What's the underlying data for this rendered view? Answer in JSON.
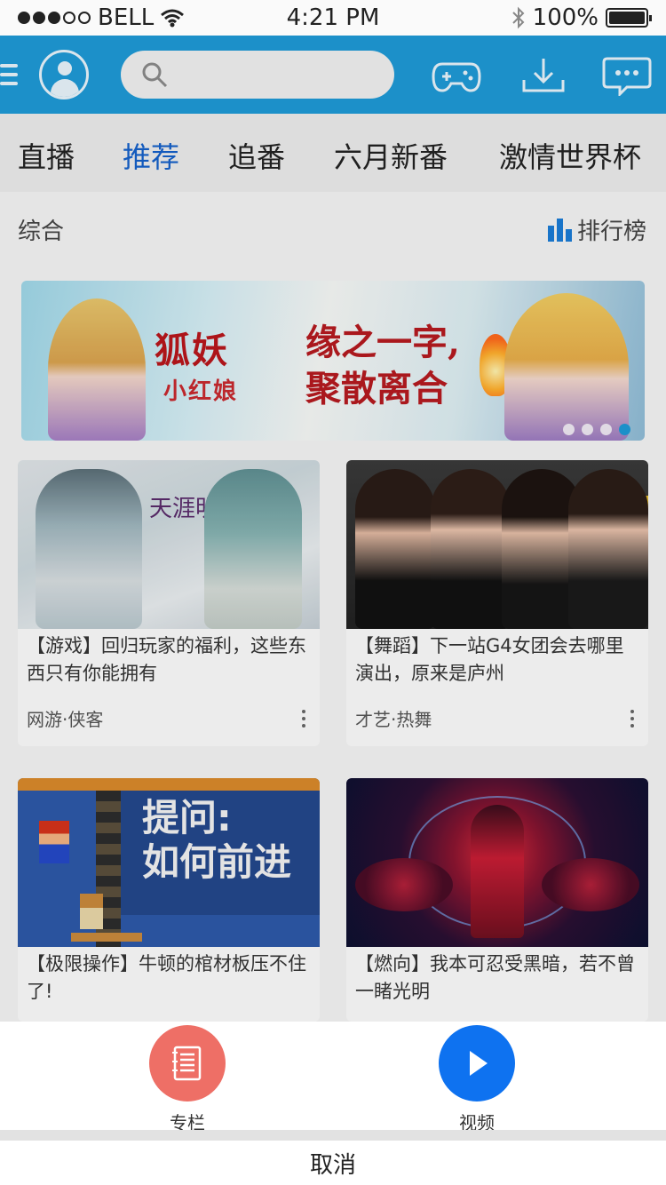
{
  "status_bar": {
    "carrier": "BELL",
    "time": "4:21 PM",
    "battery": "100%",
    "battery_level": 1.0
  },
  "header": {
    "search_placeholder": "",
    "icons": [
      "menu-icon",
      "avatar-icon",
      "search-icon",
      "gamepad-icon",
      "download-icon",
      "message-icon"
    ]
  },
  "tabs": [
    {
      "label": "直播",
      "active": false
    },
    {
      "label": "推荐",
      "active": true
    },
    {
      "label": "追番",
      "active": false
    },
    {
      "label": "六月新番",
      "active": false
    },
    {
      "label": "激情世界杯",
      "active": false
    }
  ],
  "section": {
    "title": "综合",
    "ranking_label": "排行榜"
  },
  "banner": {
    "logo_text": "狐妖",
    "logo_sub": "小红娘",
    "slogan_line1": "缘之一字,",
    "slogan_line2": "聚散离合",
    "page_count": 4,
    "active_page": 4
  },
  "cards": [
    {
      "title": "【游戏】回归玩家的福利，这些东西只有你能拥有",
      "category": "网游·侠客",
      "thumb_text": "天涯明月刀"
    },
    {
      "title": "【舞蹈】下一站G4女团会去哪里演出，原来是庐州",
      "category": "才艺·热舞"
    },
    {
      "title": "【极限操作】牛顿的棺材板压不住了!",
      "thumb_text_line1": "提问:",
      "thumb_text_line2": "如何前进"
    },
    {
      "title": "【燃向】我本可忍受黑暗，若不曾一睹光明"
    }
  ],
  "action_sheet": {
    "items": [
      {
        "label": "专栏",
        "icon": "article-icon",
        "color": "#ee6f66"
      },
      {
        "label": "视频",
        "icon": "play-icon",
        "color": "#0e72f0"
      }
    ],
    "cancel_label": "取消"
  }
}
